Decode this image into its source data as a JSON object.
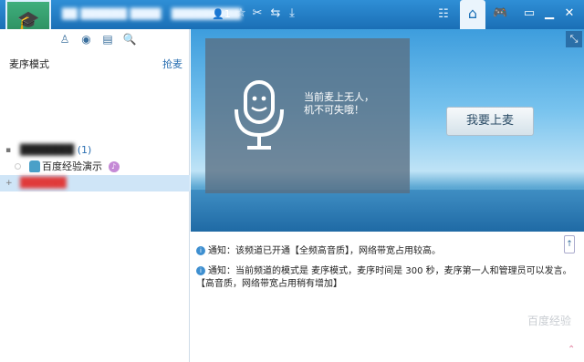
{
  "titlebar": {
    "channel_name": "██ ██████ ████",
    "channel_id": "█████████",
    "online_count": "1"
  },
  "left": {
    "mode_label": "麦序模式",
    "grab_label": "抢麦",
    "tree": {
      "channel_label": "███████",
      "channel_count": "(1)",
      "subchannel_label": "百度经验演示",
      "user_label": "██████"
    }
  },
  "stage": {
    "empty_line1": "当前麦上无人，",
    "empty_line2": "机不可失哦！",
    "go_mic_label": "我要上麦"
  },
  "chat": {
    "notice1": "通知：该频道已开通【全频高音质】，网络带宽占用较高。",
    "notice2": "通知：当前频道的模式是 麦序模式，麦序时间是 300 秒，麦序第一人和管理员可以发言。【高音质，网络带宽占用稍有增加】",
    "watermark": "百度经验"
  },
  "icons": [
    "grad-cap-icon",
    "users-icon",
    "star-icon",
    "scissors-icon",
    "download-icon",
    "list-icon",
    "home-icon",
    "gamepad-icon",
    "minimize-icon",
    "maximize-icon",
    "close-icon",
    "member-icon",
    "location-icon",
    "notes-icon",
    "search-icon",
    "microphone-icon"
  ]
}
